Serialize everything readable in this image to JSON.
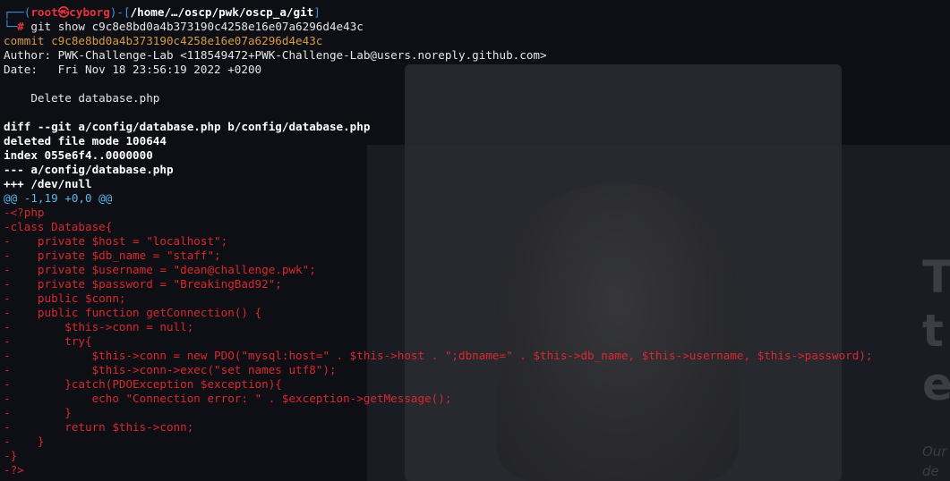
{
  "prompt": {
    "open_paren": "(",
    "user": "root",
    "at_symbol": "㉿",
    "host": "cyborg",
    "separator": ")-[",
    "path": "/home/…/oscp/pwk/oscp_a/git",
    "close_bracket": "]",
    "hash": "#",
    "command": "git show c9c8e8bd0a4b373190c4258e16e07a6296d4e43c"
  },
  "commit": {
    "line": "commit c9c8e8bd0a4b373190c4258e16e07a6296d4e43c",
    "author": "Author: PWK-Challenge-Lab <118549472+PWK-Challenge-Lab@users.noreply.github.com>",
    "date": "Date:   Fri Nov 18 23:56:19 2022 +0200",
    "message": "    Delete database.php"
  },
  "diff_header": {
    "diff": "diff --git a/config/database.php b/config/database.php",
    "deleted": "deleted file mode 100644",
    "index": "index 055e6f4..0000000",
    "minus_file": "--- a/config/database.php",
    "plus_file": "+++ /dev/null",
    "hunk": "@@ -1,19 +0,0 @@"
  },
  "removed_lines": [
    "-<?php",
    "-class Database{",
    "-    private $host = \"localhost\";",
    "-    private $db_name = \"staff\";",
    "-    private $username = \"dean@challenge.pwk\";",
    "-    private $password = \"BreakingBad92\";",
    "-    public $conn;",
    "-    public function getConnection() {",
    "-        $this->conn = null;",
    "-        try{",
    "-            $this->conn = new PDO(\"mysql:host=\" . $this->host . \";dbname=\" . $this->db_name, $this->username, $this->password);",
    "-            $this->conn->exec(\"set names utf8\");",
    "-        }catch(PDOException $exception){",
    "-            echo \"Connection error: \" . $exception->getMessage();",
    "-        }",
    "-        return $this->conn;",
    "-    }",
    "-}",
    "-?>"
  ],
  "background": {
    "heading_letters": [
      "T",
      "t",
      "e"
    ],
    "sub_letters": [
      "Our",
      "de"
    ]
  }
}
